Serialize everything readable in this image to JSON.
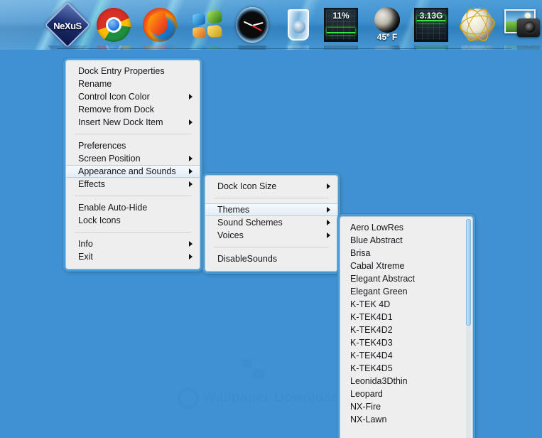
{
  "desktop": {
    "background_color": "#4091d3",
    "watermark_text": "Wallpaper Downloads"
  },
  "dock": {
    "items": [
      {
        "name": "nexus",
        "label": "NeXuS",
        "icon": "nexus-logo-icon"
      },
      {
        "name": "chrome",
        "label": "",
        "icon": "google-chrome-icon"
      },
      {
        "name": "firefox",
        "label": "",
        "icon": "mozilla-firefox-icon"
      },
      {
        "name": "windows",
        "label": "",
        "icon": "windows-start-icon"
      },
      {
        "name": "clock",
        "label": "",
        "icon": "analog-clock-icon"
      },
      {
        "name": "recycle-bin",
        "label": "",
        "icon": "recycle-bin-glass-icon"
      },
      {
        "name": "cpu-meter",
        "label": "11%",
        "icon": "cpu-usage-monitor-icon"
      },
      {
        "name": "weather",
        "label": "45º F",
        "icon": "moon-weather-icon"
      },
      {
        "name": "memory-meter",
        "label": "3.13G",
        "icon": "memory-usage-monitor-icon"
      },
      {
        "name": "network-globe",
        "label": "",
        "icon": "network-globe-icon"
      },
      {
        "name": "photo-camera",
        "label": "",
        "icon": "photo-gallery-camera-icon"
      }
    ]
  },
  "menu_main": {
    "items": [
      {
        "label": "Dock Entry Properties",
        "submenu": false,
        "selected": false
      },
      {
        "label": "Rename",
        "submenu": false,
        "selected": false
      },
      {
        "label": "Control Icon Color",
        "submenu": true,
        "selected": false
      },
      {
        "label": "Remove from Dock",
        "submenu": false,
        "selected": false
      },
      {
        "label": "Insert New Dock Item",
        "submenu": true,
        "selected": false
      },
      {
        "separator": true
      },
      {
        "label": "Preferences",
        "submenu": false,
        "selected": false
      },
      {
        "label": "Screen Position",
        "submenu": true,
        "selected": false
      },
      {
        "label": "Appearance and Sounds",
        "submenu": true,
        "selected": true
      },
      {
        "label": "Effects",
        "submenu": true,
        "selected": false
      },
      {
        "separator": true
      },
      {
        "label": "Enable Auto-Hide",
        "submenu": false,
        "selected": false
      },
      {
        "label": "Lock Icons",
        "submenu": false,
        "selected": false
      },
      {
        "separator": true
      },
      {
        "label": "Info",
        "submenu": true,
        "selected": false
      },
      {
        "label": "Exit",
        "submenu": true,
        "selected": false
      }
    ]
  },
  "menu_appearance_sounds": {
    "items": [
      {
        "label": "Dock Icon Size",
        "submenu": true,
        "selected": false
      },
      {
        "separator": true
      },
      {
        "label": "Themes",
        "submenu": true,
        "selected": true
      },
      {
        "label": "Sound Schemes",
        "submenu": true,
        "selected": false
      },
      {
        "label": "Voices",
        "submenu": true,
        "selected": false
      },
      {
        "separator": true
      },
      {
        "label": "DisableSounds",
        "submenu": false,
        "selected": false
      }
    ]
  },
  "menu_themes": {
    "scrollbar": {
      "visible": true,
      "thumb_top_pct": 0,
      "thumb_height_pct": 47
    },
    "items": [
      {
        "label": "Aero LowRes"
      },
      {
        "label": "Blue Abstract"
      },
      {
        "label": "Brisa"
      },
      {
        "label": "Cabal Xtreme"
      },
      {
        "label": "Elegant Abstract"
      },
      {
        "label": "Elegant Green"
      },
      {
        "label": "K-TEK 4D"
      },
      {
        "label": "K-TEK4D1"
      },
      {
        "label": "K-TEK4D2"
      },
      {
        "label": "K-TEK4D3"
      },
      {
        "label": "K-TEK4D4"
      },
      {
        "label": "K-TEK4D5"
      },
      {
        "label": "Leonida3Dthin"
      },
      {
        "label": "Leopard"
      },
      {
        "label": "NX-Fire"
      },
      {
        "label": "NX-Lawn"
      }
    ]
  }
}
